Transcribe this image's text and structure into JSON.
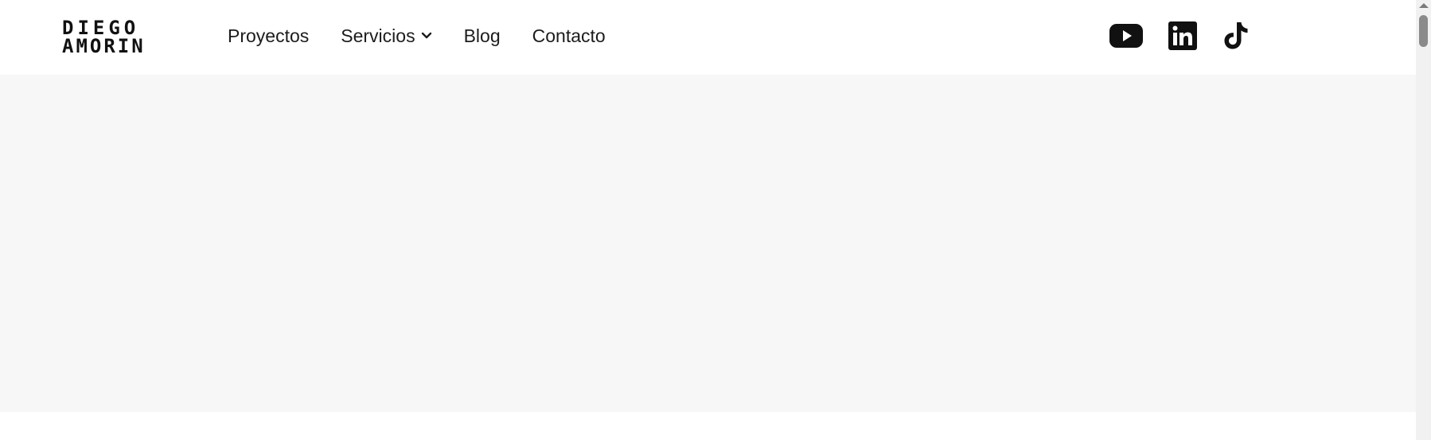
{
  "brand": {
    "logo_line1": "DIEGO",
    "logo_line2": "AMORIN"
  },
  "nav": {
    "items": [
      {
        "label": "Proyectos"
      },
      {
        "label": "Servicios",
        "has_dropdown": true
      },
      {
        "label": "Blog"
      },
      {
        "label": "Contacto"
      }
    ]
  },
  "socials": {
    "icons": [
      "youtube-icon",
      "linkedin-icon",
      "tiktok-icon"
    ]
  },
  "colors": {
    "text": "#1c1c1c",
    "header_bg": "#ffffff",
    "hero_bg": "#f7f7f7",
    "scroll_thumb": "#8a8a8a"
  }
}
